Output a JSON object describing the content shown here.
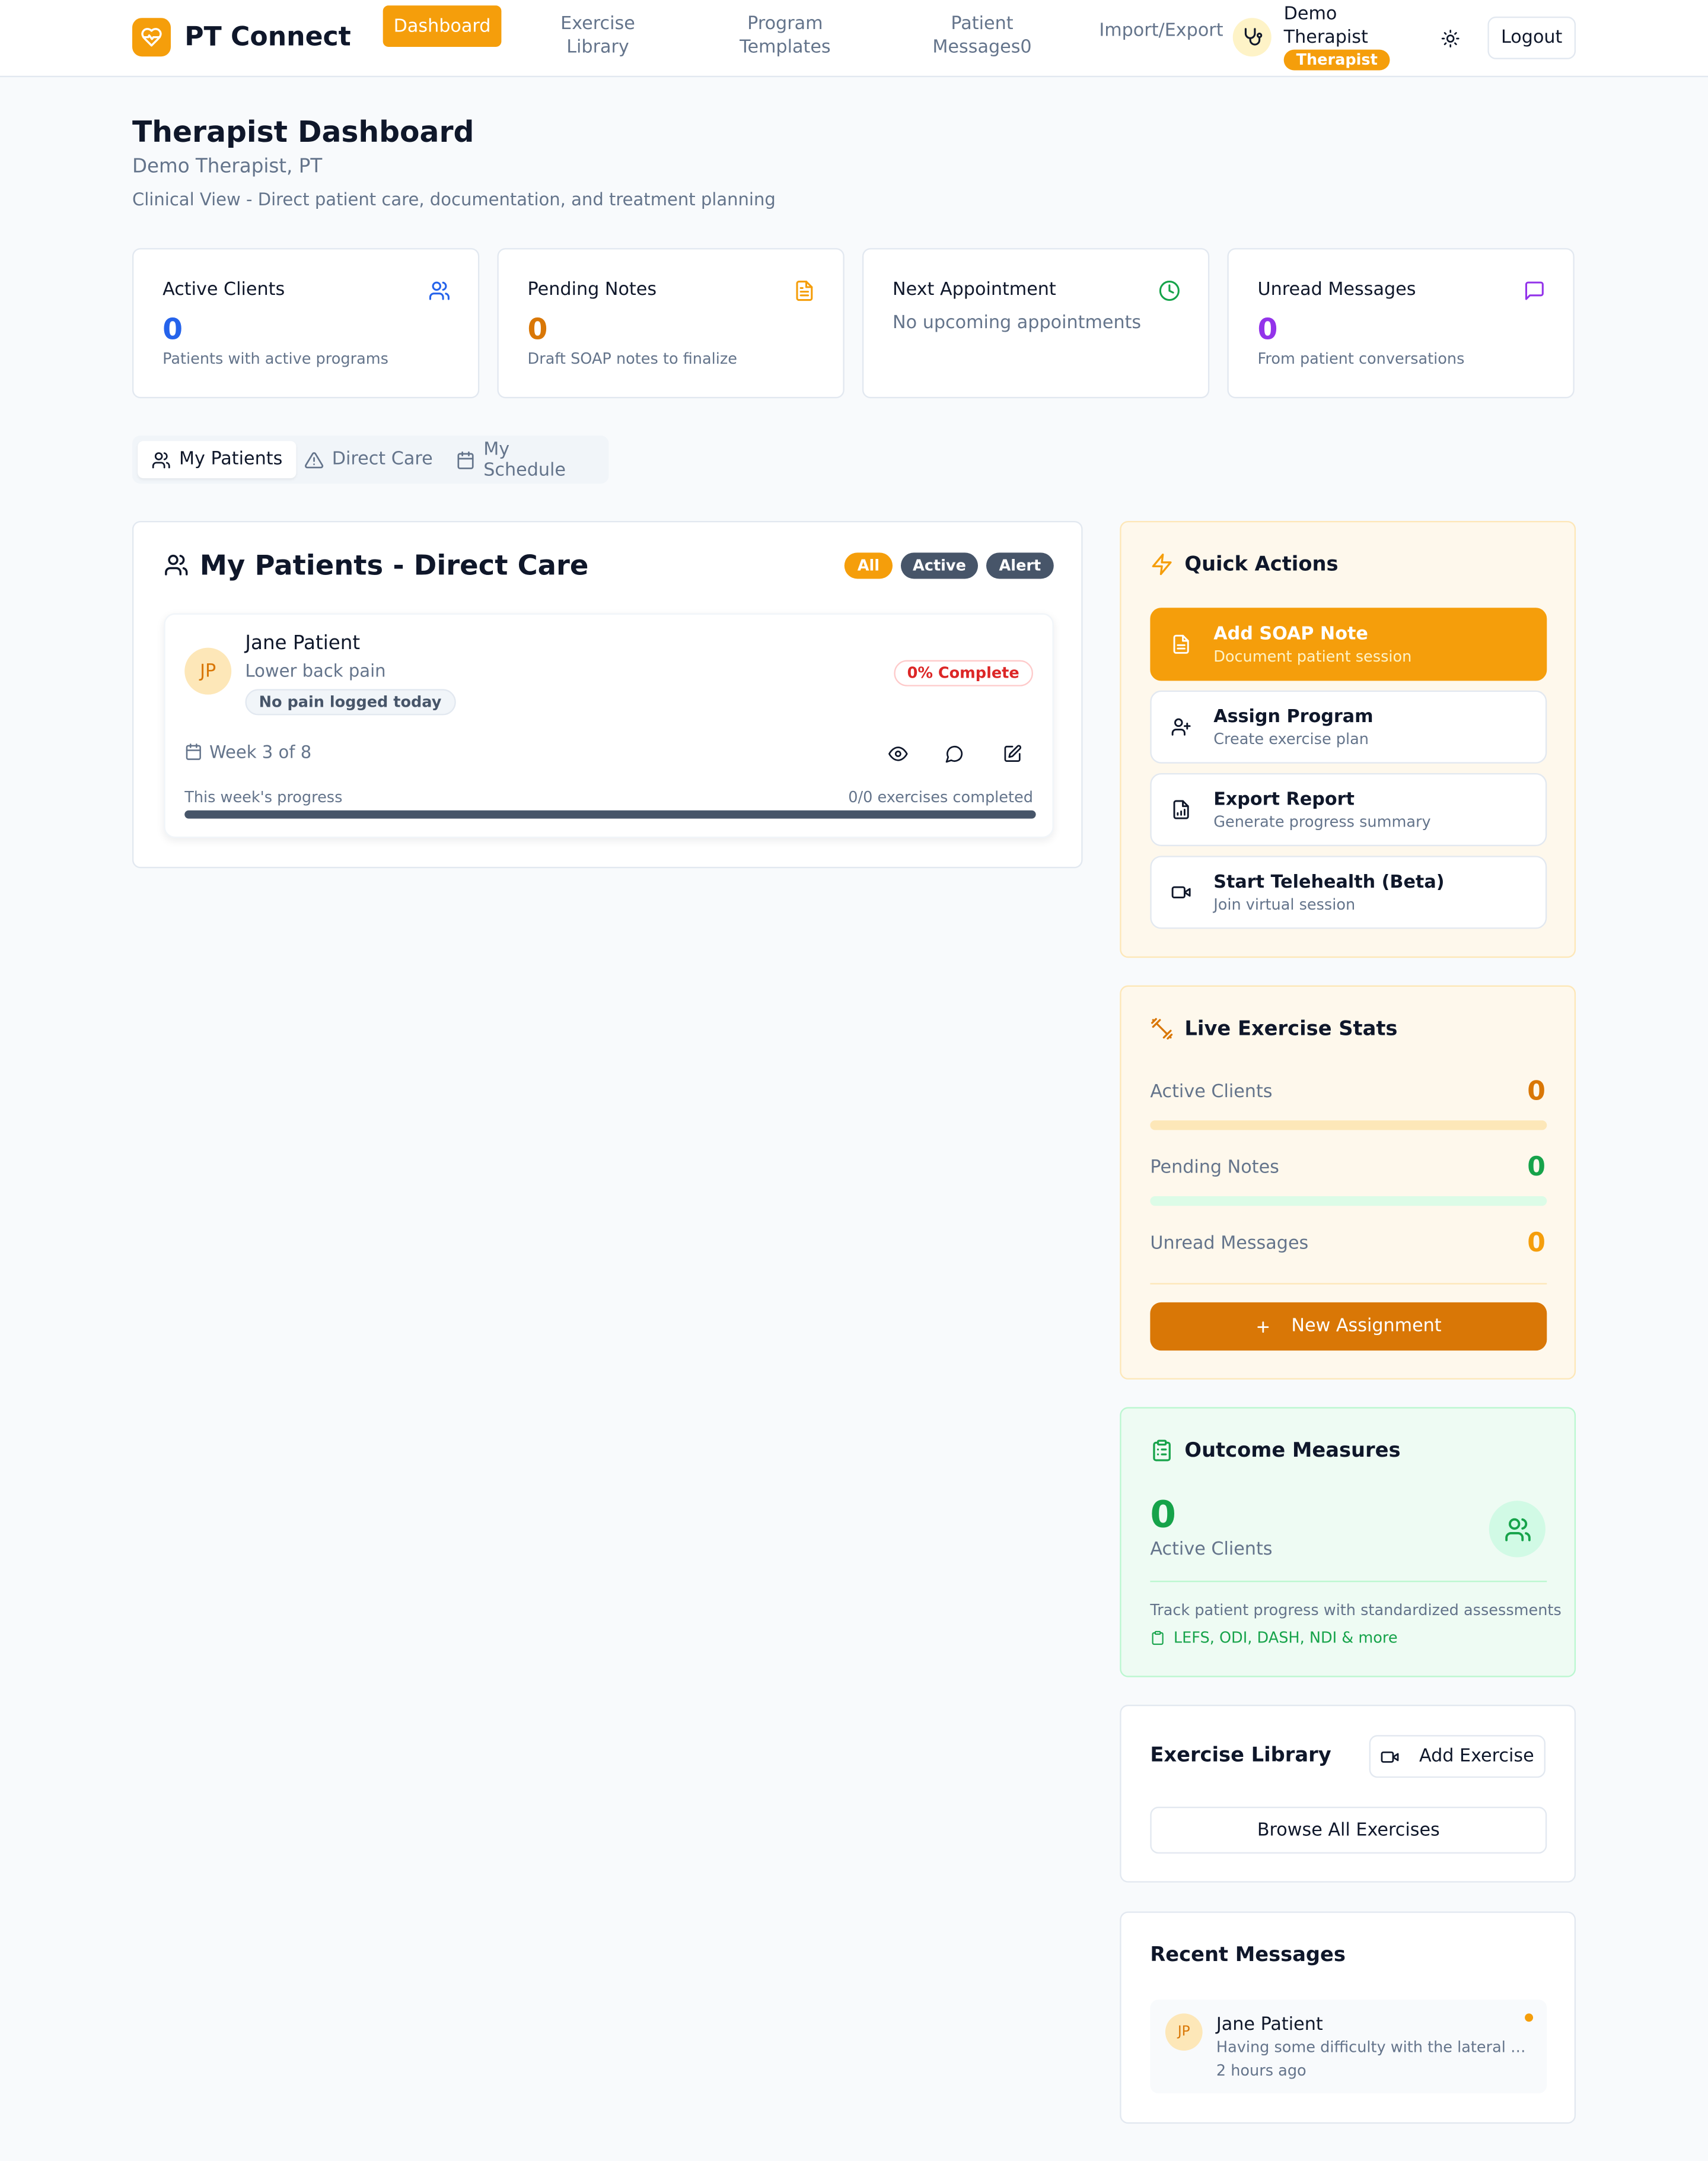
{
  "colors": {
    "accent": "#f59e0b",
    "accent_dark": "#d97706",
    "blue": "#2563eb",
    "orange": "#d97706",
    "purple": "#9333ea",
    "green": "#16a34a",
    "red": "#dc2626",
    "dark_slate": "#475569"
  },
  "app": {
    "name": "PT Connect",
    "logo_icon": "heart-pulse-icon"
  },
  "nav": {
    "items": [
      {
        "label": "Dashboard",
        "active": true
      },
      {
        "label": "Exercise Library"
      },
      {
        "label": "Program Templates"
      },
      {
        "label": "Patient Messages0"
      },
      {
        "label": "Import/Export"
      }
    ]
  },
  "user": {
    "name": "Demo Therapist",
    "role": "Therapist",
    "icon": "stethoscope-icon"
  },
  "header": {
    "theme_icon": "sun-icon",
    "logout": "Logout"
  },
  "page": {
    "title": "Therapist Dashboard",
    "subtitle": "Demo Therapist, PT",
    "description": "Clinical View - Direct patient care, documentation, and treatment planning"
  },
  "stats": [
    {
      "label": "Active Clients",
      "value": "0",
      "sub": "Patients with active programs",
      "icon": "users-icon",
      "color": "#2563eb"
    },
    {
      "label": "Pending Notes",
      "value": "0",
      "sub": "Draft SOAP notes to finalize",
      "icon": "file-text-icon",
      "color": "#d97706"
    },
    {
      "label": "Next Appointment",
      "value": "",
      "sub": "No upcoming appointments",
      "icon": "clock-icon",
      "color": "#16a34a"
    },
    {
      "label": "Unread Messages",
      "value": "0",
      "sub": "From patient conversations",
      "icon": "message-square-icon",
      "color": "#9333ea"
    }
  ],
  "tabs": [
    {
      "label": "My Patients",
      "icon": "users-icon",
      "active": true
    },
    {
      "label": "Direct Care",
      "icon": "alert-triangle-icon"
    },
    {
      "label": "My Schedule",
      "icon": "calendar-icon"
    }
  ],
  "patients_panel": {
    "title": "My Patients - Direct Care",
    "filters": [
      {
        "label": "All",
        "color": "#f59e0b"
      },
      {
        "label": "Active",
        "color": "#475569"
      },
      {
        "label": "Alert",
        "color": "#475569"
      }
    ],
    "patient": {
      "initials": "JP",
      "name": "Jane Patient",
      "condition": "Lower back pain",
      "pain_status": "No pain logged today",
      "completion": "0% Complete",
      "week": "Week 3 of 8",
      "progress_label": "This week's progress",
      "progress_count": "0/0 exercises completed",
      "progress_fraction": 0,
      "actions": [
        "eye-icon",
        "message-circle-icon",
        "edit-icon"
      ]
    }
  },
  "quick_actions": {
    "title": "Quick Actions",
    "icon": "zap-icon",
    "items": [
      {
        "label": "Add SOAP Note",
        "sub": "Document patient session",
        "icon": "file-text-icon",
        "primary": true
      },
      {
        "label": "Assign Program",
        "sub": "Create exercise plan",
        "icon": "user-plus-icon"
      },
      {
        "label": "Export Report",
        "sub": "Generate progress summary",
        "icon": "file-chart-icon"
      },
      {
        "label": "Start Telehealth (Beta)",
        "sub": "Join virtual session",
        "icon": "video-icon"
      }
    ]
  },
  "live_stats": {
    "title": "Live Exercise Stats",
    "icon": "dumbbell-icon",
    "rows": [
      {
        "label": "Active Clients",
        "value": "0",
        "color": "#d97706",
        "bar_color": "#fde7b8"
      },
      {
        "label": "Pending Notes",
        "value": "0",
        "color": "#16a34a",
        "bar_color": "#dcfce7"
      },
      {
        "label": "Unread Messages",
        "value": "0",
        "color": "#f59e0b"
      }
    ],
    "button": "New Assignment",
    "button_icon": "plus-icon"
  },
  "outcome": {
    "title": "Outcome Measures",
    "icon": "clipboard-list-icon",
    "value": "0",
    "label": "Active Clients",
    "circle_icon": "users-icon",
    "description": "Track patient progress with standardized assessments",
    "measures": "LEFS, ODI, DASH, NDI & more",
    "measures_icon": "clipboard-icon"
  },
  "library": {
    "title": "Exercise Library",
    "add_button": "Add Exercise",
    "add_icon": "video-icon",
    "browse_button": "Browse All Exercises"
  },
  "messages": {
    "title": "Recent Messages",
    "items": [
      {
        "initials": "JP",
        "name": "Jane Patient",
        "text": "Having some difficulty with the lateral ra...",
        "time": "2 hours ago",
        "unread": true
      }
    ]
  }
}
